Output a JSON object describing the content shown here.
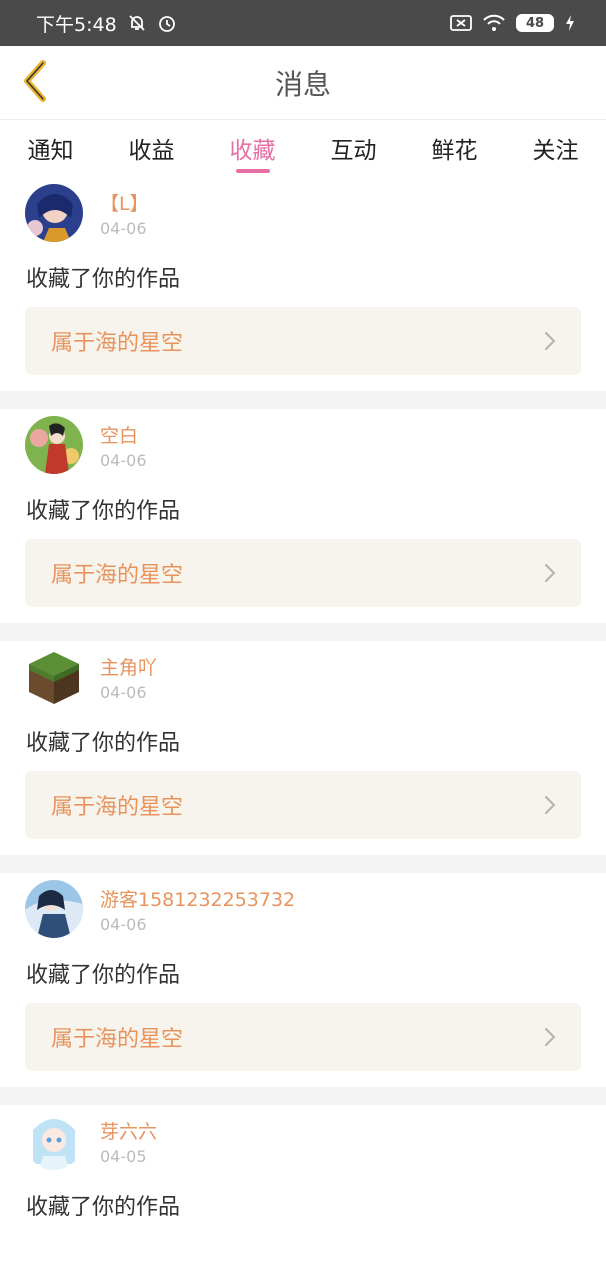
{
  "status_bar": {
    "time": "下午5:48",
    "battery": "48",
    "icons": [
      "mute-bell-icon",
      "alarm-icon",
      "sim-off-icon",
      "wifi-icon",
      "charging-icon"
    ]
  },
  "header": {
    "title": "消息",
    "back_icon": "chevron-left-icon"
  },
  "tabs": [
    {
      "label": "通知",
      "active": false
    },
    {
      "label": "收益",
      "active": false
    },
    {
      "label": "收藏",
      "active": true
    },
    {
      "label": "互动",
      "active": false
    },
    {
      "label": "鲜花",
      "active": false
    },
    {
      "label": "关注",
      "active": false
    }
  ],
  "feed": [
    {
      "user": "【L】",
      "date": "04-06",
      "action": "收藏了你的作品",
      "work": "属于海的星空"
    },
    {
      "user": "空白",
      "date": "04-06",
      "action": "收藏了你的作品",
      "work": "属于海的星空"
    },
    {
      "user": "主角吖",
      "date": "04-06",
      "action": "收藏了你的作品",
      "work": "属于海的星空"
    },
    {
      "user": "游客1581232253732",
      "date": "04-06",
      "action": "收藏了你的作品",
      "work": "属于海的星空"
    },
    {
      "user": "芽六六",
      "date": "04-05",
      "action": "收藏了你的作品",
      "work": ""
    }
  ],
  "colors": {
    "accent": "#e86fa4",
    "username": "#e8935e",
    "card_bg": "#f6f4ec",
    "status_bar": "#4a4a4a"
  }
}
